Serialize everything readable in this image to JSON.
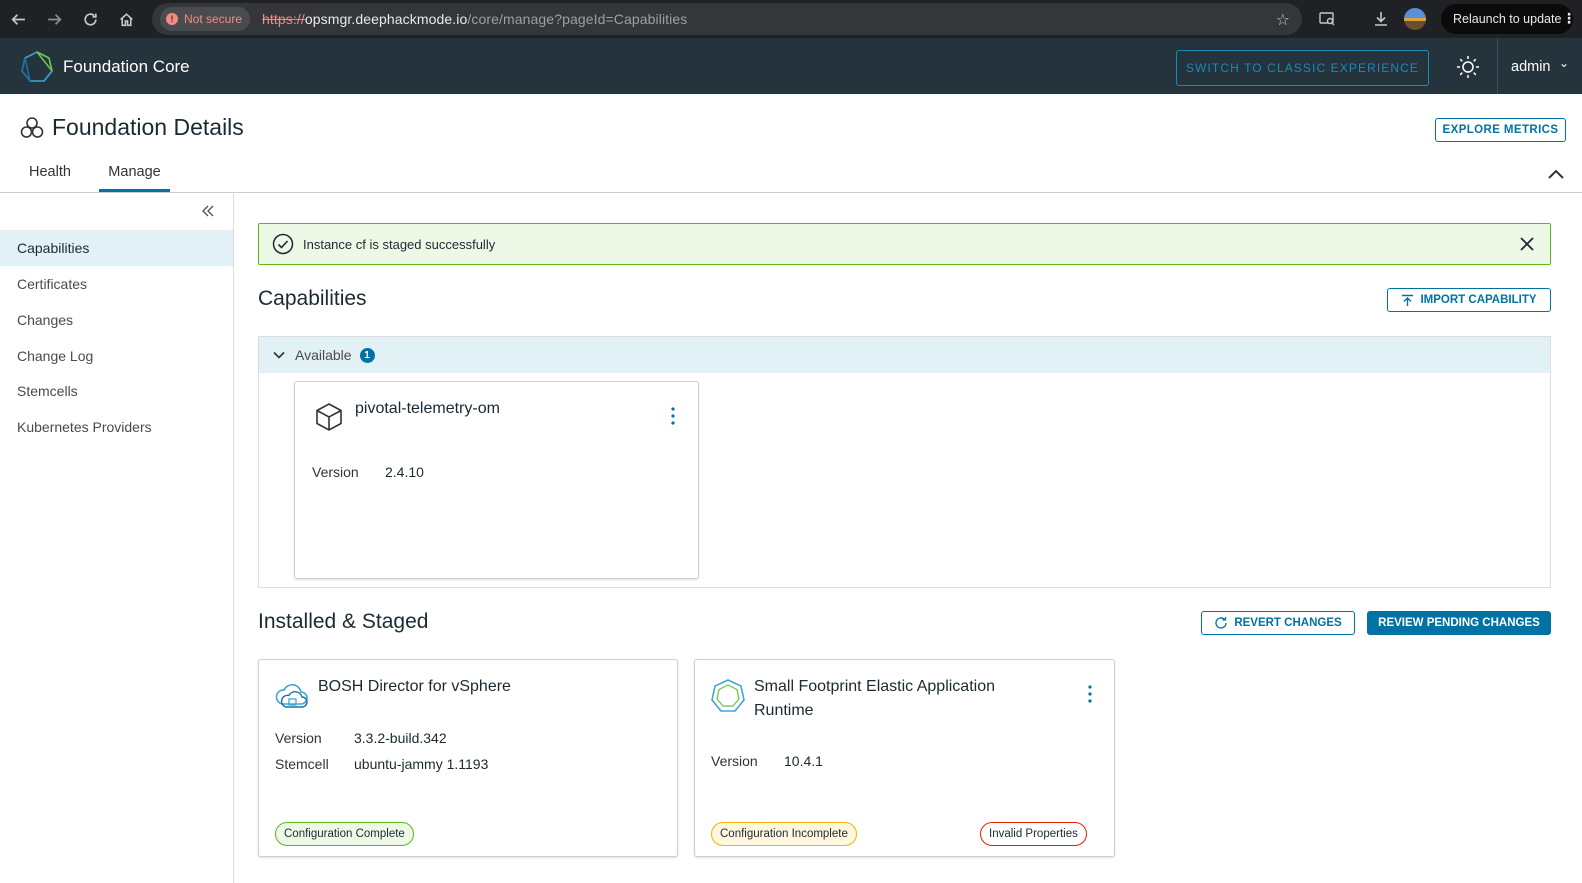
{
  "browser": {
    "security_label": "Not secure",
    "url_scheme": "https://",
    "url_host": "opsmgr.deephackmode.io",
    "url_path": "/core/manage?pageId=Capabilities",
    "relaunch_label": "Relaunch to update"
  },
  "header": {
    "brand": "Foundation Core",
    "switch_label": "SWITCH TO CLASSIC EXPERIENCE",
    "user": "admin"
  },
  "page": {
    "title": "Foundation Details",
    "explore_label": "EXPLORE METRICS",
    "tabs": [
      {
        "label": "Health"
      },
      {
        "label": "Manage"
      }
    ],
    "active_tab": "Manage"
  },
  "sidebar": {
    "items": [
      {
        "label": "Capabilities"
      },
      {
        "label": "Certificates"
      },
      {
        "label": "Changes"
      },
      {
        "label": "Change Log"
      },
      {
        "label": "Stemcells"
      },
      {
        "label": "Kubernetes Providers"
      }
    ],
    "active": "Capabilities"
  },
  "alert": {
    "message": "Instance cf is staged successfully"
  },
  "capabilities": {
    "title": "Capabilities",
    "import_label": "IMPORT CAPABILITY",
    "available_label": "Available",
    "available_count": "1",
    "available_cards": [
      {
        "name": "pivotal-telemetry-om",
        "version_label": "Version",
        "version": "2.4.10"
      }
    ]
  },
  "installed": {
    "title": "Installed & Staged",
    "revert_label": "REVERT CHANGES",
    "review_label": "REVIEW PENDING CHANGES",
    "cards": [
      {
        "name": "BOSH Director for vSphere",
        "version_label": "Version",
        "version": "3.3.2-build.342",
        "stemcell_label": "Stemcell",
        "stemcell": "ubuntu-jammy 1.1193",
        "status": "Configuration Complete"
      },
      {
        "name_line1": "Small Footprint Elastic Application",
        "name_line2": "Runtime",
        "version_label": "Version",
        "version": "10.4.1",
        "status": "Configuration Incomplete",
        "warning": "Invalid Properties"
      }
    ]
  },
  "colors": {
    "accent": "#0072a3",
    "header_bg": "#25333d",
    "success": "#5eb715",
    "warning": "#f4b400",
    "danger": "#e02200"
  }
}
